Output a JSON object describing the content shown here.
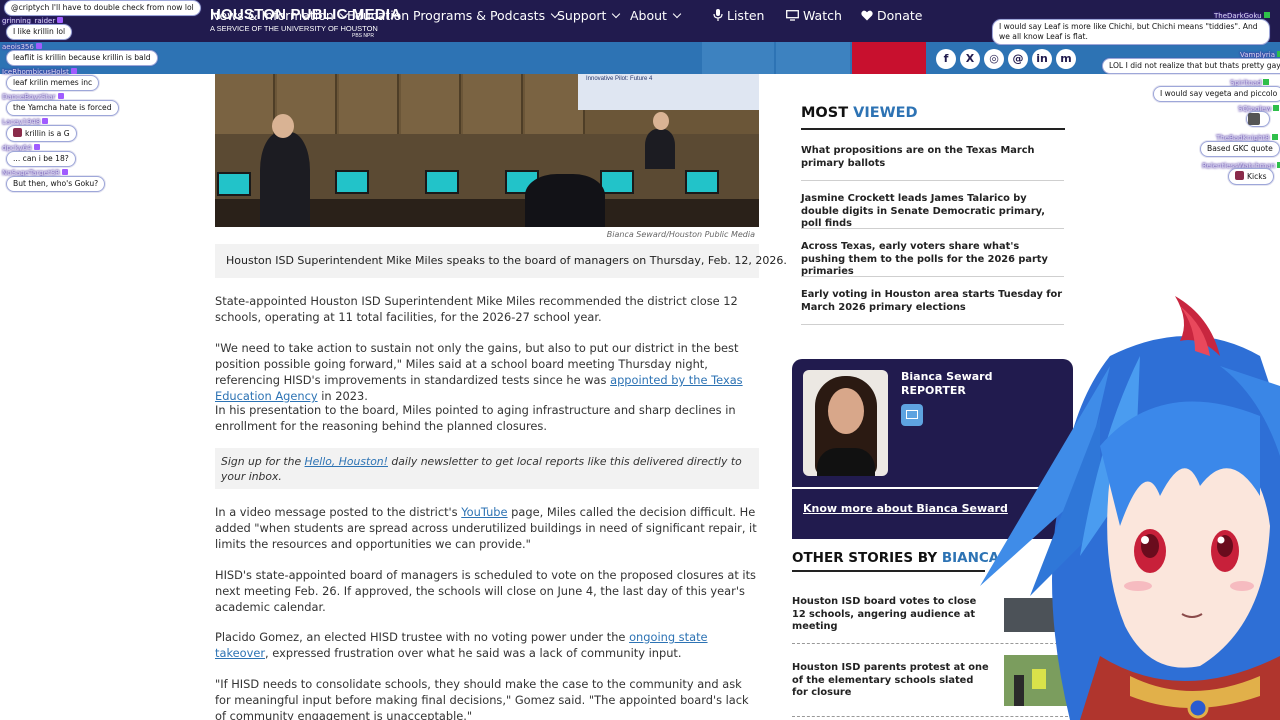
{
  "header": {
    "logo_line1": "HOUSTON PUBLIC MEDIA",
    "logo_line2": "A SERVICE OF THE UNIVERSITY OF HOUSTON",
    "logo_line3": "PBS NPR"
  },
  "nav": {
    "items": [
      {
        "label": "News & Information",
        "has_dropdown": true
      },
      {
        "label": "Education",
        "has_dropdown": false
      },
      {
        "label": "Programs & Podcasts",
        "has_dropdown": true
      },
      {
        "label": "Support",
        "has_dropdown": true
      },
      {
        "label": "About",
        "has_dropdown": true
      }
    ],
    "listen_label": "Listen",
    "watch_label": "Watch",
    "donate_label": "Donate",
    "social_icons": [
      "facebook-icon",
      "x-icon",
      "instagram-icon",
      "threads-icon",
      "linkedin-icon",
      "mastodon-icon"
    ]
  },
  "article": {
    "photo_screen_title": "Innovative Pilot: Future 4",
    "photo_credit": "Bianca Seward/Houston Public Media",
    "caption": "Houston ISD Superintendent Mike Miles speaks to the board of managers on Thursday, Feb. 12, 2026.",
    "p1": "State-appointed Houston ISD Superintendent Mike Miles recommended the district close 12 schools, operating at 11 total facilities, for the 2026-27 school year.",
    "p2_before": "\"We need to take action to sustain not only the gains, but also to put our district in the best position possible going forward,\" Miles said at a school board meeting Thursday night, referencing HISD's improvements in standardized tests since he was ",
    "p2_link": "appointed by the Texas Education Agency",
    "p2_after": " in 2023.",
    "p3": "In his presentation to the board, Miles pointed to aging infrastructure and sharp declines in enrollment for the reasoning behind the planned closures.",
    "signup_before": "Sign up for the ",
    "signup_link": "Hello, Houston!",
    "signup_after": " daily newsletter to get local reports like this delivered directly to your inbox.",
    "p4_before": "In a video message posted to the district's ",
    "p4_link": "YouTube",
    "p4_after": " page, Miles called the decision difficult. He added \"when students are spread across underutilized buildings in need of significant repair, it limits the resources and opportunities we can provide.\"",
    "p5": "HISD's state-appointed board of managers is scheduled to vote on the proposed closures at its next meeting Feb. 26. If approved, the schools will close on June 4, the last day of this year's academic calendar.",
    "p6_before": "Placido Gomez, an elected HISD trustee with no voting power under the ",
    "p6_link": "ongoing state takeover",
    "p6_after": ", expressed frustration over what he said was a lack of community input.",
    "p7": "\"If HISD needs to consolidate schools, they should make the case to the community and ask for meaningful input before making final decisions,\" Gomez said. \"The appointed board's lack of community engagement is unacceptable.\""
  },
  "sidebar": {
    "most_viewed_title_a": "MOST ",
    "most_viewed_title_b": "VIEWED",
    "most_viewed": [
      "What propositions are on the Texas March primary ballots",
      "Jasmine Crockett leads James Talarico by double digits in Senate Democratic primary, poll finds",
      "Across Texas, early voters share what's pushing them to the polls for the 2026 party primaries",
      "Early voting in Houston area starts Tuesday for March 2026 primary elections"
    ],
    "author_name": "Bianca Seward",
    "author_role": "REPORTER",
    "know_more": "Know more about Bianca Seward",
    "other_title_a": "OTHER STORIES BY ",
    "other_title_b": "BIANCA",
    "other_stories": [
      "Houston ISD board votes to close 12 schools, angering audience at meeting",
      "Houston ISD parents protest at one of the elementary schools slated for closure"
    ]
  },
  "chat_left": [
    {
      "name": "",
      "message": "@criptych I'll have to double check from now lol"
    },
    {
      "name": "grinning_raider",
      "message": "I like krillin lol"
    },
    {
      "name": "aeois356",
      "message": "leaflit is krillin because krillin is bald"
    },
    {
      "name": "IceRhombicusHolst",
      "message": "leaf krilin memes inc"
    },
    {
      "name": "DanceBoyzStar",
      "message": "the Yamcha hate is forced"
    },
    {
      "name": "Lacey1948",
      "message": "krillin is a G"
    },
    {
      "name": "dpcky64",
      "message": "... can i be 18?"
    },
    {
      "name": "NoSageTargetSR",
      "message": "But then, who's Goku?"
    }
  ],
  "chat_right": [
    {
      "name": "TheDarkGoku",
      "message": "I would say Leaf is more like Chichi, but Chichi means \"tiddies\". And we all know Leaf is flat."
    },
    {
      "name": "Vamplyria",
      "message": "LOL I did not realize that but thats pretty gay"
    },
    {
      "name": "Spiritoad",
      "message": "I would say vegeta and piccolo"
    },
    {
      "name": "SQtaglew",
      "message": ""
    },
    {
      "name": "TheBadKnight8",
      "message": "Based GKC quote"
    },
    {
      "name": "RelentlessWatchman",
      "message": "Kicks"
    }
  ],
  "colors": {
    "header_bg": "#211b4e",
    "nav_bg": "#2d73b4",
    "donate_bg": "#c8102e",
    "accent_blue": "#2d73b4",
    "author_card_bg": "#211b4e"
  }
}
